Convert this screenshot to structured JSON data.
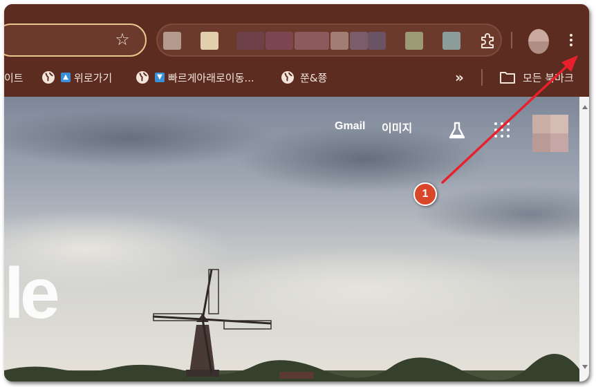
{
  "bookmarks": [
    {
      "label": "이트",
      "icon": "none"
    },
    {
      "label": "위로가기",
      "icon": "up-arrow-favicon"
    },
    {
      "label": "빠르게아래로이동...",
      "icon": "down-arrow-favicon"
    },
    {
      "label": "쭌&쭁",
      "icon": "globe-icon"
    }
  ],
  "bookmarks_overflow": "»",
  "all_bookmarks_label": "모든 북마크",
  "top_links": {
    "gmail": "Gmail",
    "images": "이미지"
  },
  "logo_fragment": "le",
  "annotation": {
    "number": "1",
    "color": "#d9472b",
    "arrow_color": "#e8202c"
  },
  "colors": {
    "toolbar": "#5c2c21",
    "omnibox_border": "#e9c88f",
    "text": "#f3e5dc"
  }
}
